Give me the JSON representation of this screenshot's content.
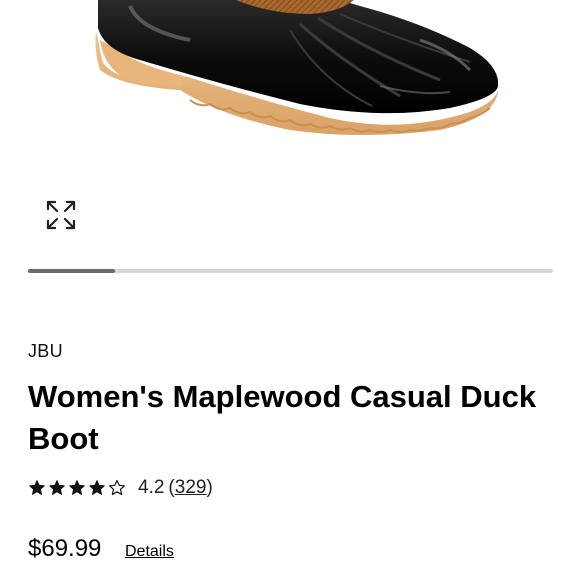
{
  "product": {
    "brand": "JBU",
    "title": "Women's Maplewood Casual Duck Boot",
    "rating": {
      "stars_filled": 4,
      "stars_total": 5,
      "value": "4.2",
      "open_paren": "(",
      "count": "329",
      "close_paren": ")"
    },
    "price": "$69.99",
    "details_label": "Details"
  },
  "gallery": {
    "expand_icon": "expand-arrows-icon",
    "scroll_progress": 0.165
  },
  "colors": {
    "boot_rubber": "#0d0d0d",
    "boot_sole": "#e2b277",
    "boot_leather": "#a9692f",
    "track": "#d6d6d6",
    "thumb": "#6b6b6b"
  }
}
